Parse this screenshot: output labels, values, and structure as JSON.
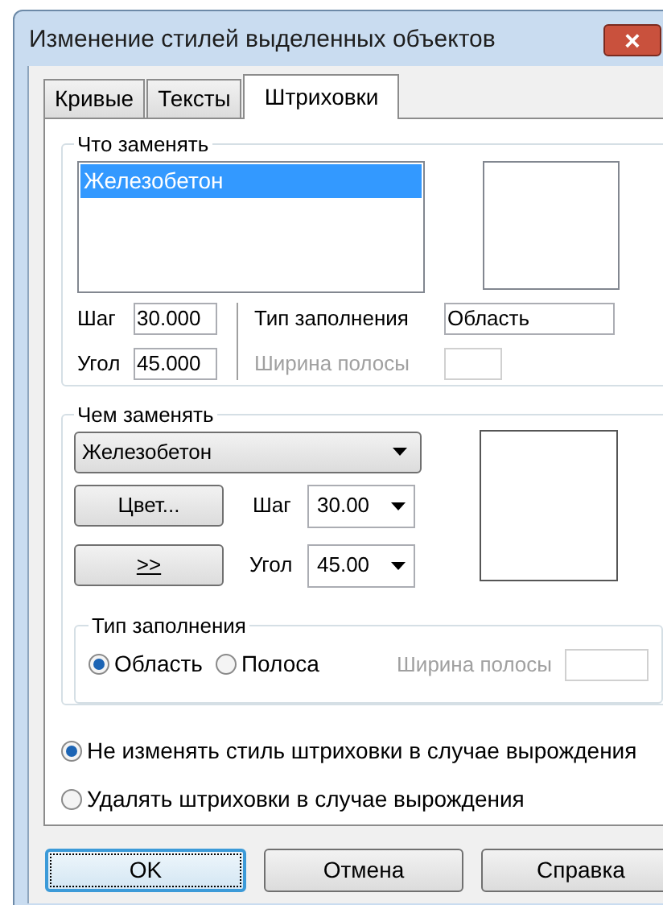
{
  "window": {
    "title": "Изменение стилей выделенных объектов",
    "close": "×"
  },
  "tabs": [
    {
      "label": "Кривые",
      "selected": false
    },
    {
      "label": "Тексты",
      "selected": false
    },
    {
      "label": "Штриховки",
      "selected": true
    }
  ],
  "replace_what": {
    "title": "Что заменять",
    "list": [
      {
        "label": "Железобетон",
        "selected": true
      }
    ],
    "step": {
      "label": "Шаг",
      "value": "30.000"
    },
    "angle": {
      "label": "Угол",
      "value": "45.000"
    },
    "fill_type": {
      "label": "Тип заполнения",
      "value": "Область"
    },
    "stripe_width": {
      "label": "Ширина полосы",
      "disabled": true
    }
  },
  "replace_with": {
    "title": "Чем заменять",
    "pattern": {
      "value": "Железобетон"
    },
    "color_button": "Цвет...",
    "more_button": ">>",
    "step": {
      "label": "Шаг",
      "value": "30.00"
    },
    "angle": {
      "label": "Угол",
      "value": "45.00"
    },
    "fill_type": {
      "title": "Тип заполнения",
      "options": [
        {
          "label": "Область",
          "selected": true
        },
        {
          "label": "Полоса",
          "selected": false
        }
      ],
      "stripe_width": {
        "label": "Ширина полосы",
        "disabled": true
      }
    }
  },
  "degenerate_options": [
    {
      "label": "Не изменять стиль штриховки в случае вырождения",
      "selected": true
    },
    {
      "label": "Удалять штриховки в случае вырождения",
      "selected": false
    }
  ],
  "buttons": [
    {
      "label": "OK",
      "default": true
    },
    {
      "label": "Отмена",
      "default": false
    },
    {
      "label": "Справка",
      "default": false
    }
  ]
}
